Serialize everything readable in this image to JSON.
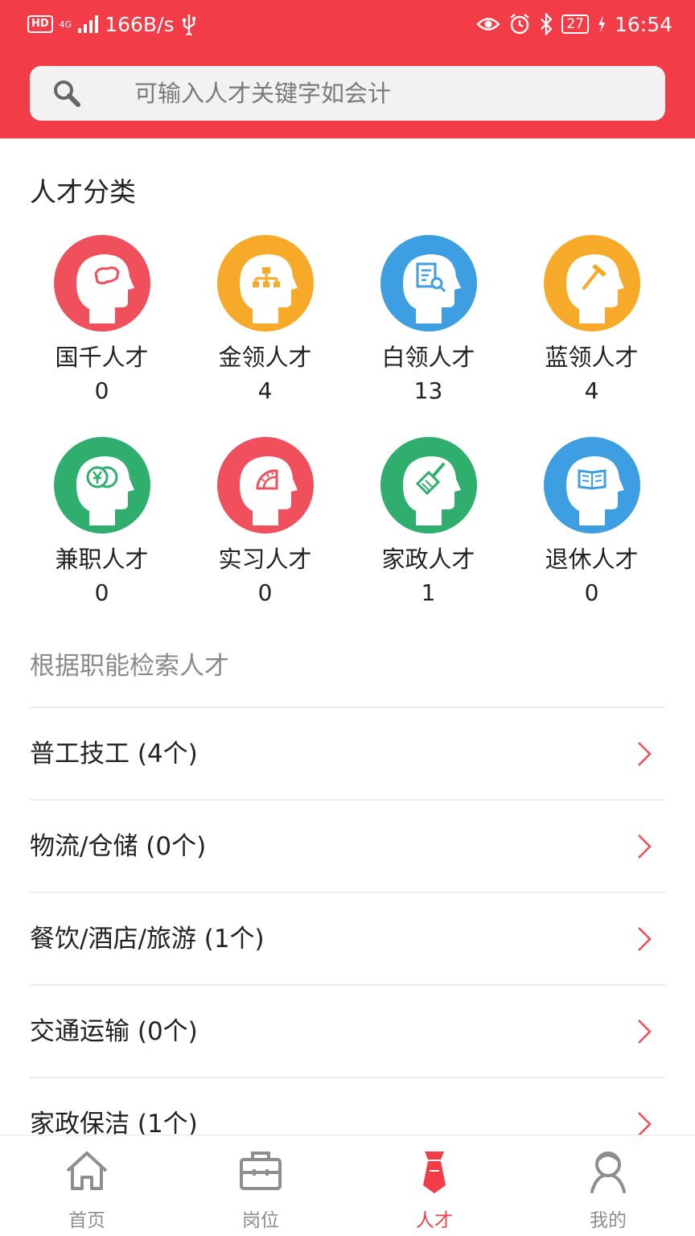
{
  "status_bar": {
    "hd": "HD",
    "network_type": "4G",
    "speed": "166B/s",
    "battery": "27",
    "time": "16:54"
  },
  "search": {
    "placeholder": "可输入人才关键字如会计"
  },
  "categories": {
    "title": "人才分类",
    "items": [
      {
        "label": "国千人才",
        "count": "0",
        "color": "#f0505c",
        "icon": "china-map-icon"
      },
      {
        "label": "金领人才",
        "count": "4",
        "color": "#f7a92a",
        "icon": "org-chart-icon"
      },
      {
        "label": "白领人才",
        "count": "13",
        "color": "#3d9fe2",
        "icon": "document-search-icon"
      },
      {
        "label": "蓝领人才",
        "count": "4",
        "color": "#f7a92a",
        "icon": "hammer-icon"
      },
      {
        "label": "兼职人才",
        "count": "0",
        "color": "#2fae6e",
        "icon": "coins-icon"
      },
      {
        "label": "实习人才",
        "count": "0",
        "color": "#f0505c",
        "icon": "protractor-icon"
      },
      {
        "label": "家政人才",
        "count": "1",
        "color": "#2fae6e",
        "icon": "broom-icon"
      },
      {
        "label": "退休人才",
        "count": "0",
        "color": "#3d9fe2",
        "icon": "book-icon"
      }
    ]
  },
  "function_search": {
    "title": "根据职能检索人才",
    "items": [
      {
        "label": "普工技工 (4个)"
      },
      {
        "label": "物流/仓储 (0个)"
      },
      {
        "label": "餐饮/酒店/旅游 (1个)"
      },
      {
        "label": "交通运输 (0个)"
      },
      {
        "label": "家政保洁 (1个)"
      }
    ]
  },
  "bottom_nav": {
    "items": [
      {
        "label": "首页",
        "icon": "home-icon"
      },
      {
        "label": "岗位",
        "icon": "briefcase-icon"
      },
      {
        "label": "人才",
        "icon": "talent-tie-icon",
        "active": true
      },
      {
        "label": "我的",
        "icon": "profile-icon"
      }
    ]
  },
  "colors": {
    "accent": "#f23d48",
    "chevron": "#f0505c",
    "inactive": "#8e8e8e"
  }
}
